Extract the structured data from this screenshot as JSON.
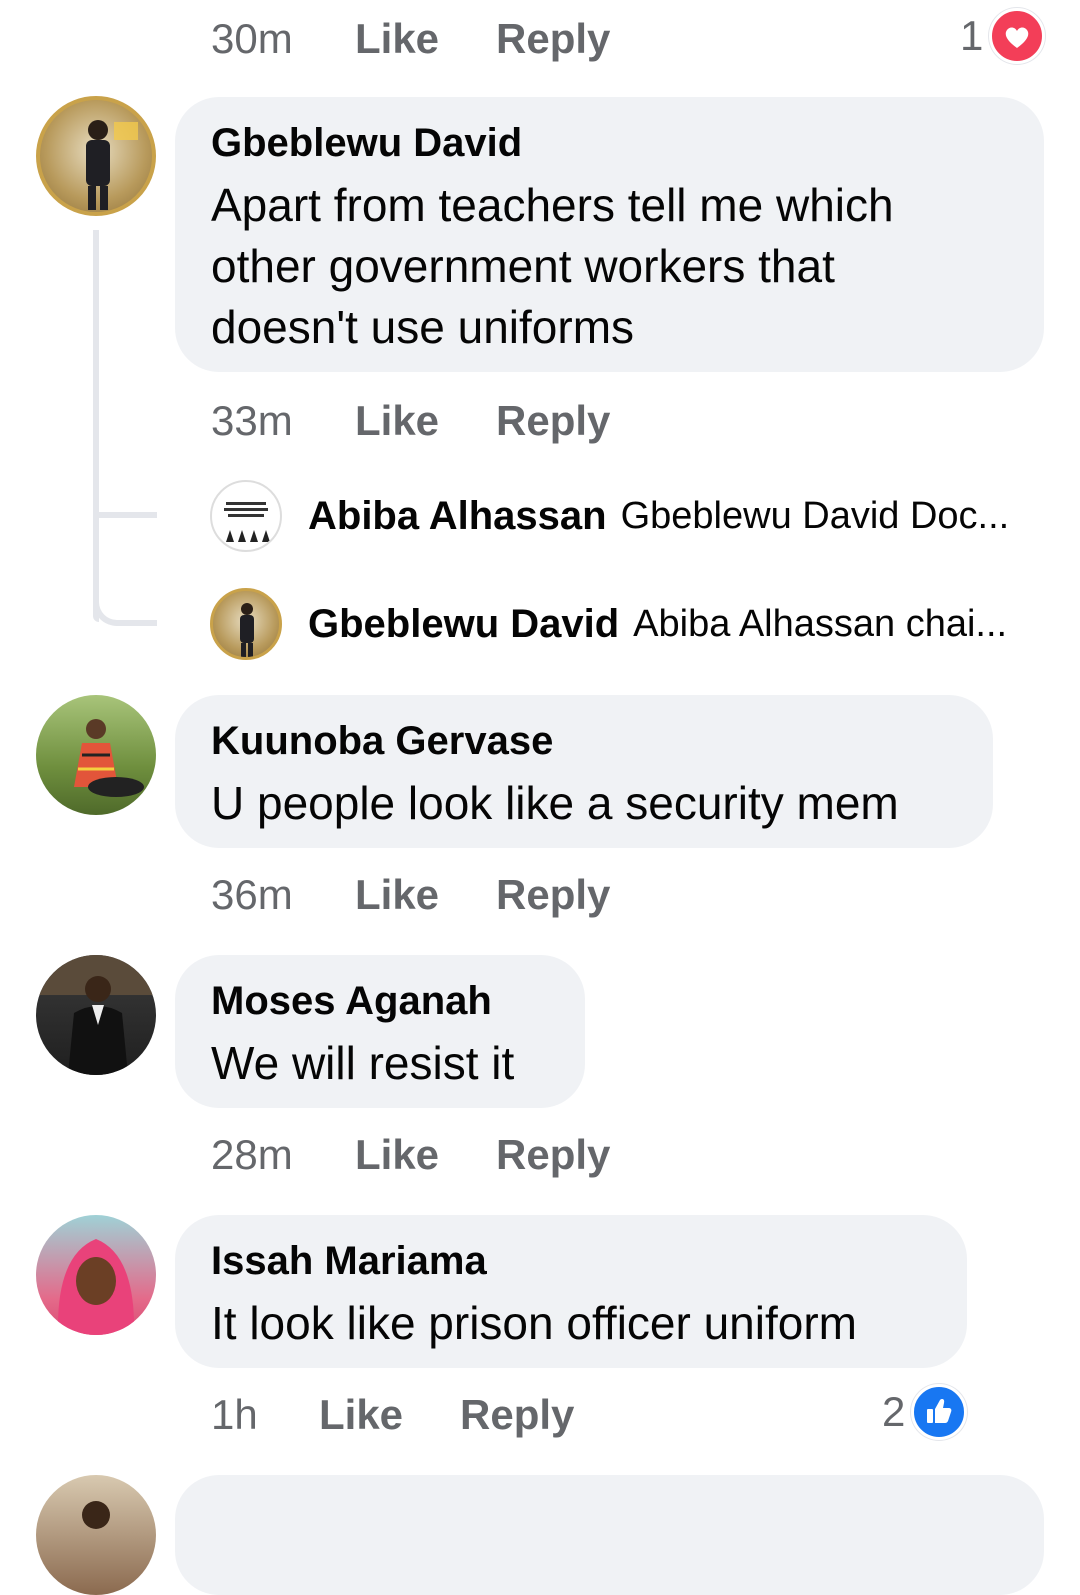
{
  "top_actions": {
    "time": "30m",
    "like": "Like",
    "reply": "Reply",
    "reaction_count": "1",
    "reaction_icon": "heart-icon"
  },
  "comments": [
    {
      "author": "Gbeblewu David",
      "text": "Apart from teachers tell me which other government workers that doesn't use uniforms",
      "time": "33m",
      "like": "Like",
      "reply": "Reply"
    },
    {
      "author": "Kuunoba Gervase",
      "text": "U people look like a security mem",
      "time": "36m",
      "like": "Like",
      "reply": "Reply"
    },
    {
      "author": "Moses Aganah",
      "text": "We will resist it",
      "time": "28m",
      "like": "Like",
      "reply": "Reply"
    },
    {
      "author": "Issah Mariama",
      "text": "It look like prison officer uniform",
      "time": "1h",
      "like": "Like",
      "reply": "Reply",
      "reaction_count": "2",
      "reaction_icon": "thumbs-up-icon"
    }
  ],
  "replies": [
    {
      "author": "Abiba Alhassan",
      "text": "Gbeblewu David Doc..."
    },
    {
      "author": "Gbeblewu David",
      "text": "Abiba Alhassan chai..."
    }
  ],
  "colors": {
    "bubble": "#f0f2f5",
    "meta_text": "#65676b",
    "heart": "#f33e58",
    "like_blue": "#1877f2"
  }
}
